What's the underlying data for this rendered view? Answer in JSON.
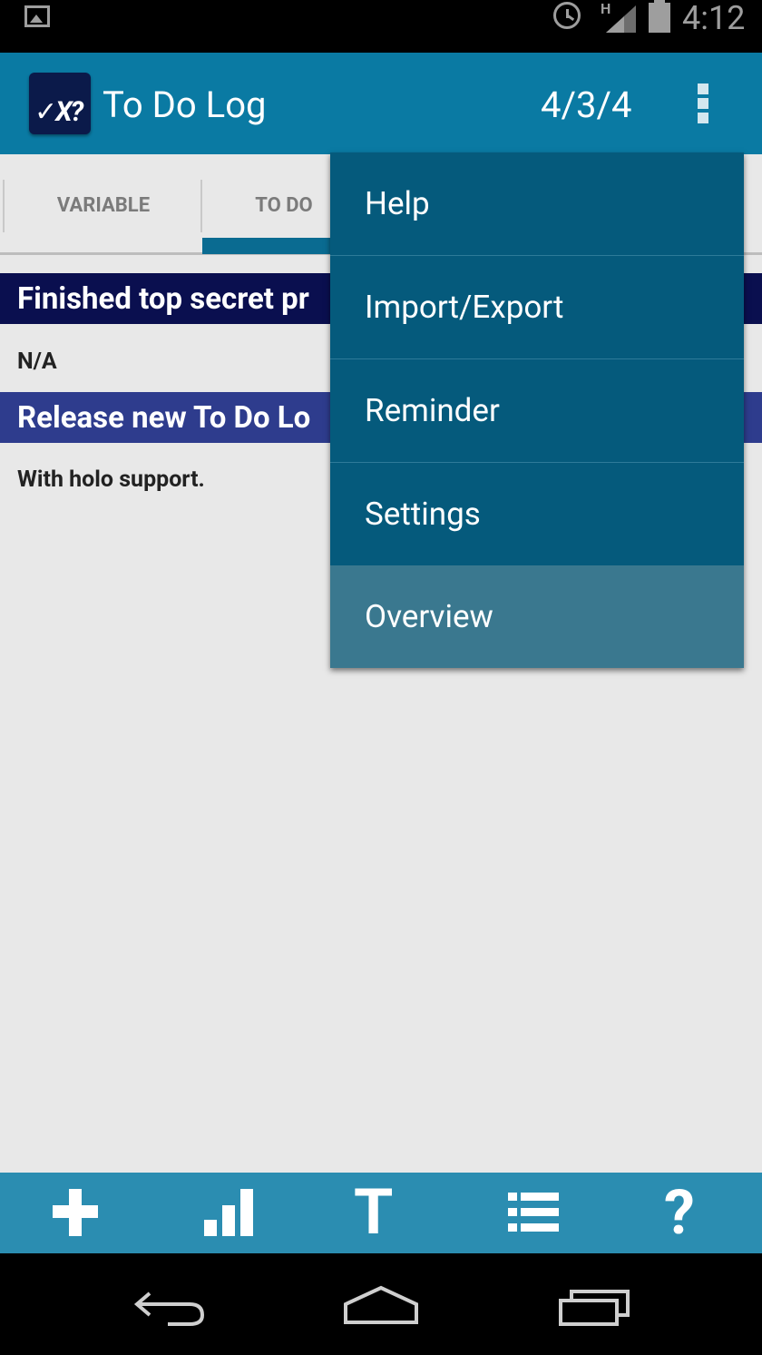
{
  "status_bar": {
    "time": "4:12",
    "network": "H"
  },
  "action_bar": {
    "logo_text": "✓X?",
    "title": "To Do Log",
    "counter": "4/3/4"
  },
  "tabs": [
    {
      "label": "VARIABLE"
    },
    {
      "label": "TO DO"
    }
  ],
  "items": [
    {
      "title": "Finished top secret pr",
      "header_color": "#0a0f4f",
      "body": "N/A"
    },
    {
      "title": "Release new To Do Lo",
      "header_color": "#2e3c8d",
      "body": "With holo support."
    }
  ],
  "menu": {
    "items": [
      {
        "label": "Help"
      },
      {
        "label": "Import/Export"
      },
      {
        "label": "Reminder"
      },
      {
        "label": "Settings"
      },
      {
        "label": "Overview"
      }
    ],
    "highlighted": "Overview"
  },
  "toolbar": {
    "buttons": [
      {
        "icon": "plus-icon"
      },
      {
        "icon": "bar-chart-icon"
      },
      {
        "icon": "text-icon",
        "glyph": "T"
      },
      {
        "icon": "list-icon"
      },
      {
        "icon": "help-icon",
        "glyph": "?"
      }
    ]
  },
  "nav_bar": {
    "buttons": [
      "back-icon",
      "home-icon",
      "recents-icon"
    ]
  },
  "colors": {
    "action_bar": "#0a7aa3",
    "menu": "#055a7c",
    "menu_highlight": "#3a788f",
    "toolbar": "#2b8db1"
  }
}
